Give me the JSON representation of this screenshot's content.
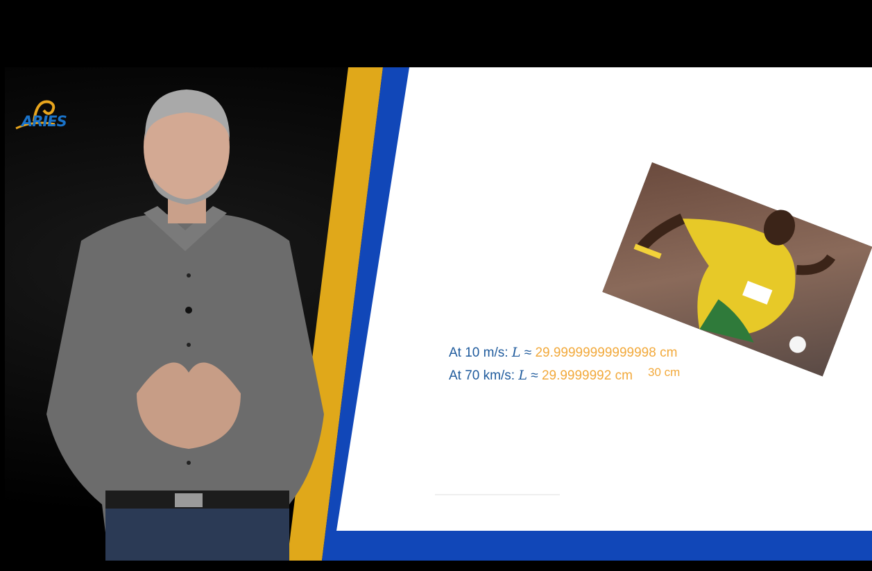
{
  "logo": {
    "text": "ARIES"
  },
  "slide": {
    "photo_caption": "30 cm",
    "lines": [
      {
        "prefix": "At 10 m/s: ",
        "variable": "L",
        "approx": " ≈ ",
        "value": "29.99999999999998 cm"
      },
      {
        "prefix": "At 70 km/s: ",
        "variable": "L",
        "approx": " ≈ ",
        "value": "29.9999992 cm"
      }
    ]
  },
  "colors": {
    "accent_yellow": "#e0a81a",
    "accent_blue": "#1147b8",
    "text_blue": "#1e5a9c",
    "text_orange": "#f2a93b"
  },
  "icons": {
    "logo": "aries-logo-icon",
    "photo": "sprinter-photo"
  }
}
